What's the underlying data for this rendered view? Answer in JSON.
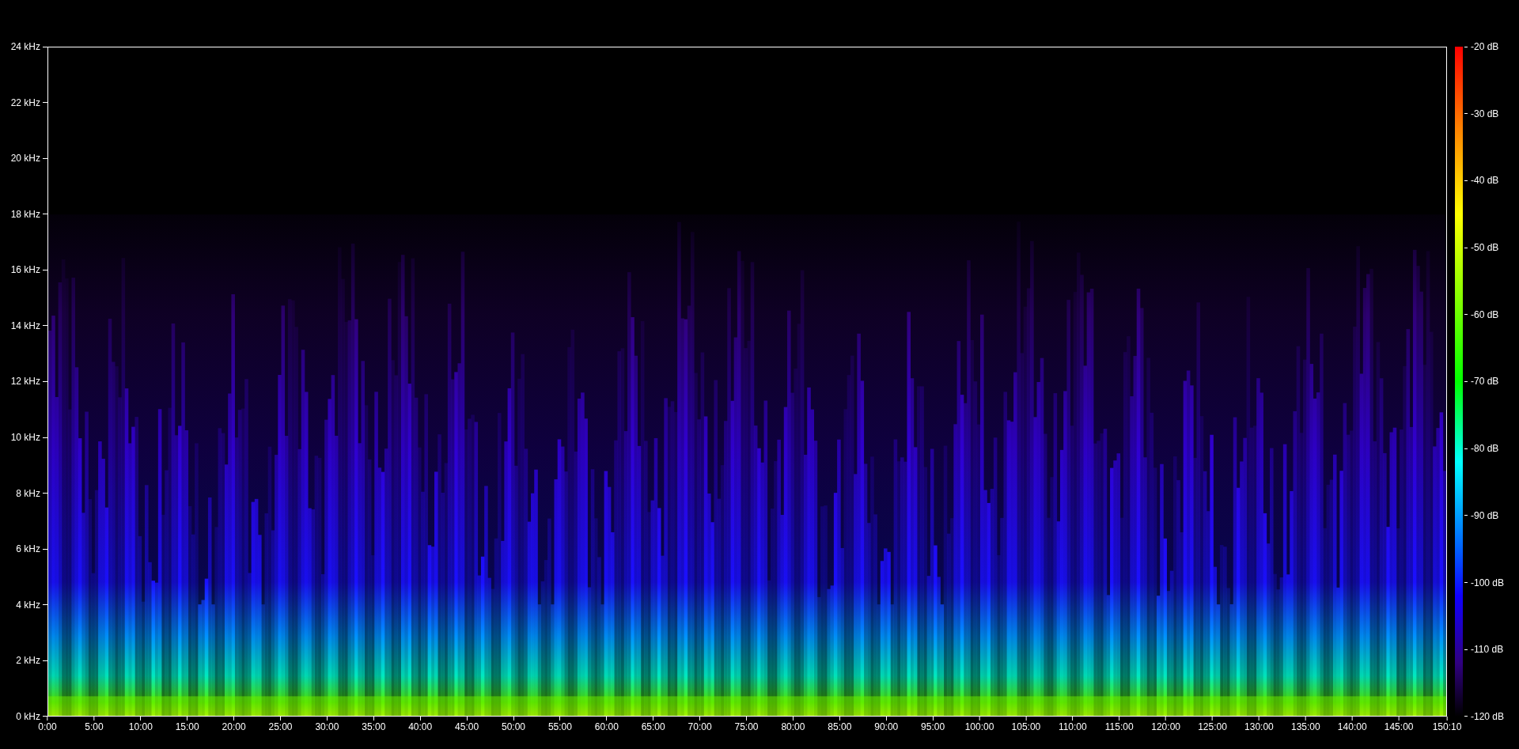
{
  "y_axis": {
    "labels": [
      "24 kHz",
      "22 kHz",
      "20 kHz",
      "18 kHz",
      "16 kHz",
      "14 kHz",
      "12 kHz",
      "10 kHz",
      "8 kHz",
      "6 kHz",
      "4 kHz",
      "2 kHz",
      "0 kHz"
    ]
  },
  "x_axis": {
    "labels": [
      "0:00",
      "5:00",
      "10:00",
      "15:00",
      "20:00",
      "25:00",
      "30:00",
      "35:00",
      "40:00",
      "45:00",
      "50:00",
      "55:00",
      "60:00",
      "65:00",
      "70:00",
      "75:00",
      "80:00",
      "85:00",
      "90:00",
      "95:00",
      "100:00",
      "105:00",
      "110:00",
      "115:00",
      "120:00",
      "125:00",
      "130:00",
      "135:00",
      "140:00",
      "145:00",
      "150:10"
    ]
  },
  "color_scale": {
    "labels": [
      "-20 dB",
      "-30 dB",
      "-40 dB",
      "-50 dB",
      "-60 dB",
      "-70 dB",
      "-80 dB",
      "-90 dB",
      "-100 dB",
      "-110 dB",
      "-120 dB"
    ]
  }
}
